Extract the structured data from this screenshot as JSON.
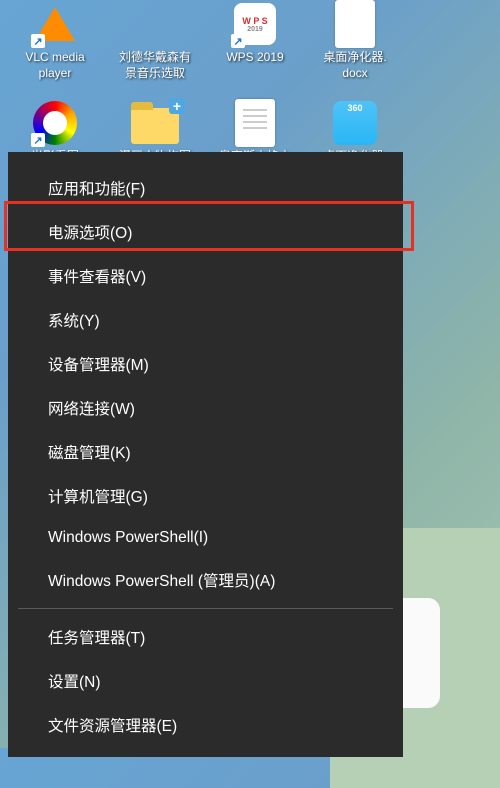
{
  "desktop": {
    "row1": [
      {
        "name": "vlc-icon",
        "label": "VLC media\nplayer"
      },
      {
        "name": "music-icon",
        "label": "刘德华戴森有\n景音乐选取"
      },
      {
        "name": "wps-icon",
        "label": "WPS 2019"
      },
      {
        "name": "cleaner-icon",
        "label": "桌面净化器.\ndocx"
      }
    ],
    "row2": [
      {
        "name": "photo-icon",
        "label": "光影看图"
      },
      {
        "name": "folder-icon",
        "label": "漫画人物构图"
      },
      {
        "name": "text-icon",
        "label": "奥克斯火焰山"
      },
      {
        "name": "cleaner2-icon",
        "label": "桌面净化器."
      }
    ]
  },
  "context_menu": {
    "groups": [
      [
        {
          "key": "apps",
          "label": "应用和功能(F)"
        },
        {
          "key": "power",
          "label": "电源选项(O)"
        },
        {
          "key": "events",
          "label": "事件查看器(V)"
        },
        {
          "key": "system",
          "label": "系统(Y)"
        },
        {
          "key": "devmgr",
          "label": "设备管理器(M)"
        },
        {
          "key": "network",
          "label": "网络连接(W)"
        },
        {
          "key": "disk",
          "label": "磁盘管理(K)"
        },
        {
          "key": "compmgmt",
          "label": "计算机管理(G)"
        },
        {
          "key": "ps",
          "label": "Windows PowerShell(I)"
        },
        {
          "key": "psadmin",
          "label": "Windows PowerShell (管理员)(A)"
        }
      ],
      [
        {
          "key": "taskmgr",
          "label": "任务管理器(T)"
        },
        {
          "key": "settings",
          "label": "设置(N)"
        },
        {
          "key": "explorer",
          "label": "文件资源管理器(E)"
        }
      ]
    ]
  },
  "wps_text": "W P S"
}
